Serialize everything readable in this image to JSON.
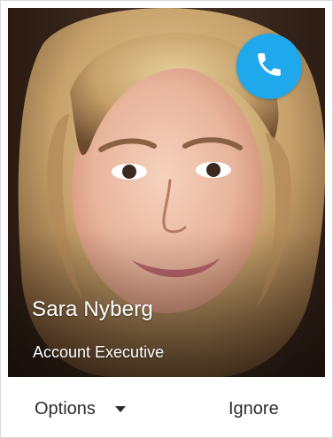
{
  "caller": {
    "name": "Sara Nyberg",
    "title": "Account Executive",
    "photo": "caller-portrait"
  },
  "call_button": {
    "icon": "phone-icon",
    "color": "#1fa8ec"
  },
  "actions": {
    "options_label": "Options",
    "options_icon": "caret-down-icon",
    "ignore_label": "Ignore"
  }
}
